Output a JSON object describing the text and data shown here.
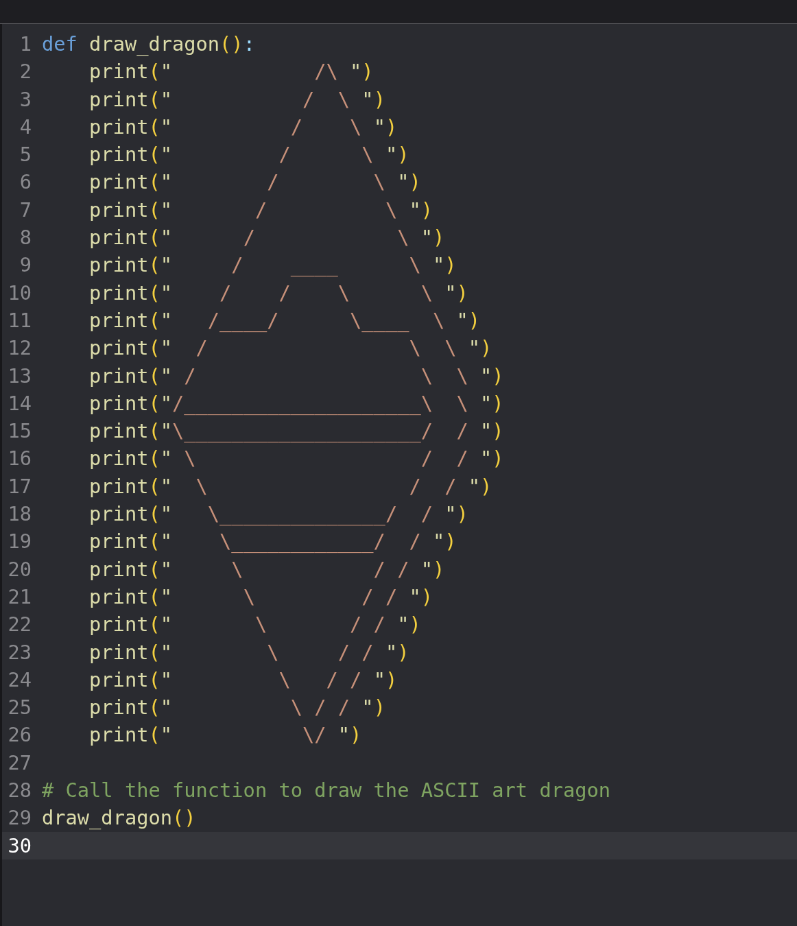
{
  "editor": {
    "lines": [
      {
        "number": "1",
        "indented": false,
        "current": false,
        "tokens": [
          {
            "kind": "keyword",
            "text": "def",
            "spaced": false
          },
          {
            "kind": "name",
            "text": "draw_dragon",
            "spaced": true
          },
          {
            "kind": "paren",
            "text": "()"
          },
          {
            "kind": "colon",
            "text": ":"
          }
        ]
      },
      {
        "number": "2",
        "indented": true,
        "current": false,
        "tokens": [
          {
            "kind": "name",
            "text": "print"
          },
          {
            "kind": "paren",
            "text": "("
          },
          {
            "kind": "quote",
            "text": "\""
          },
          {
            "kind": "art",
            "text": "            /\\ "
          },
          {
            "kind": "quote",
            "text": "\""
          },
          {
            "kind": "paren",
            "text": ")"
          }
        ]
      },
      {
        "number": "3",
        "indented": true,
        "current": false,
        "tokens": [
          {
            "kind": "name",
            "text": "print"
          },
          {
            "kind": "paren",
            "text": "("
          },
          {
            "kind": "quote",
            "text": "\""
          },
          {
            "kind": "art",
            "text": "           /  \\ "
          },
          {
            "kind": "quote",
            "text": "\""
          },
          {
            "kind": "paren",
            "text": ")"
          }
        ]
      },
      {
        "number": "4",
        "indented": true,
        "current": false,
        "tokens": [
          {
            "kind": "name",
            "text": "print"
          },
          {
            "kind": "paren",
            "text": "("
          },
          {
            "kind": "quote",
            "text": "\""
          },
          {
            "kind": "art",
            "text": "          /    \\ "
          },
          {
            "kind": "quote",
            "text": "\""
          },
          {
            "kind": "paren",
            "text": ")"
          }
        ]
      },
      {
        "number": "5",
        "indented": true,
        "current": false,
        "tokens": [
          {
            "kind": "name",
            "text": "print"
          },
          {
            "kind": "paren",
            "text": "("
          },
          {
            "kind": "quote",
            "text": "\""
          },
          {
            "kind": "art",
            "text": "         /      \\ "
          },
          {
            "kind": "quote",
            "text": "\""
          },
          {
            "kind": "paren",
            "text": ")"
          }
        ]
      },
      {
        "number": "6",
        "indented": true,
        "current": false,
        "tokens": [
          {
            "kind": "name",
            "text": "print"
          },
          {
            "kind": "paren",
            "text": "("
          },
          {
            "kind": "quote",
            "text": "\""
          },
          {
            "kind": "art",
            "text": "        /        \\ "
          },
          {
            "kind": "quote",
            "text": "\""
          },
          {
            "kind": "paren",
            "text": ")"
          }
        ]
      },
      {
        "number": "7",
        "indented": true,
        "current": false,
        "tokens": [
          {
            "kind": "name",
            "text": "print"
          },
          {
            "kind": "paren",
            "text": "("
          },
          {
            "kind": "quote",
            "text": "\""
          },
          {
            "kind": "art",
            "text": "       /          \\ "
          },
          {
            "kind": "quote",
            "text": "\""
          },
          {
            "kind": "paren",
            "text": ")"
          }
        ]
      },
      {
        "number": "8",
        "indented": true,
        "current": false,
        "tokens": [
          {
            "kind": "name",
            "text": "print"
          },
          {
            "kind": "paren",
            "text": "("
          },
          {
            "kind": "quote",
            "text": "\""
          },
          {
            "kind": "art",
            "text": "      /            \\ "
          },
          {
            "kind": "quote",
            "text": "\""
          },
          {
            "kind": "paren",
            "text": ")"
          }
        ]
      },
      {
        "number": "9",
        "indented": true,
        "current": false,
        "tokens": [
          {
            "kind": "name",
            "text": "print"
          },
          {
            "kind": "paren",
            "text": "("
          },
          {
            "kind": "quote",
            "text": "\""
          },
          {
            "kind": "art",
            "text": "     /    ____      \\ "
          },
          {
            "kind": "quote",
            "text": "\""
          },
          {
            "kind": "paren",
            "text": ")"
          }
        ]
      },
      {
        "number": "10",
        "indented": true,
        "current": false,
        "tokens": [
          {
            "kind": "name",
            "text": "print"
          },
          {
            "kind": "paren",
            "text": "("
          },
          {
            "kind": "quote",
            "text": "\""
          },
          {
            "kind": "art",
            "text": "    /    /    \\      \\ "
          },
          {
            "kind": "quote",
            "text": "\""
          },
          {
            "kind": "paren",
            "text": ")"
          }
        ]
      },
      {
        "number": "11",
        "indented": true,
        "current": false,
        "tokens": [
          {
            "kind": "name",
            "text": "print"
          },
          {
            "kind": "paren",
            "text": "("
          },
          {
            "kind": "quote",
            "text": "\""
          },
          {
            "kind": "art",
            "text": "   /____/      \\____  \\ "
          },
          {
            "kind": "quote",
            "text": "\""
          },
          {
            "kind": "paren",
            "text": ")"
          }
        ]
      },
      {
        "number": "12",
        "indented": true,
        "current": false,
        "tokens": [
          {
            "kind": "name",
            "text": "print"
          },
          {
            "kind": "paren",
            "text": "("
          },
          {
            "kind": "quote",
            "text": "\""
          },
          {
            "kind": "art",
            "text": "  /                 \\  \\ "
          },
          {
            "kind": "quote",
            "text": "\""
          },
          {
            "kind": "paren",
            "text": ")"
          }
        ]
      },
      {
        "number": "13",
        "indented": true,
        "current": false,
        "tokens": [
          {
            "kind": "name",
            "text": "print"
          },
          {
            "kind": "paren",
            "text": "("
          },
          {
            "kind": "quote",
            "text": "\""
          },
          {
            "kind": "art",
            "text": " /                   \\  \\ "
          },
          {
            "kind": "quote",
            "text": "\""
          },
          {
            "kind": "paren",
            "text": ")"
          }
        ]
      },
      {
        "number": "14",
        "indented": true,
        "current": false,
        "tokens": [
          {
            "kind": "name",
            "text": "print"
          },
          {
            "kind": "paren",
            "text": "("
          },
          {
            "kind": "quote",
            "text": "\""
          },
          {
            "kind": "art",
            "text": "/____________________\\  \\ "
          },
          {
            "kind": "quote",
            "text": "\""
          },
          {
            "kind": "paren",
            "text": ")"
          }
        ]
      },
      {
        "number": "15",
        "indented": true,
        "current": false,
        "tokens": [
          {
            "kind": "name",
            "text": "print"
          },
          {
            "kind": "paren",
            "text": "("
          },
          {
            "kind": "quote",
            "text": "\""
          },
          {
            "kind": "art",
            "text": "\\____________________/  / "
          },
          {
            "kind": "quote",
            "text": "\""
          },
          {
            "kind": "paren",
            "text": ")"
          }
        ]
      },
      {
        "number": "16",
        "indented": true,
        "current": false,
        "tokens": [
          {
            "kind": "name",
            "text": "print"
          },
          {
            "kind": "paren",
            "text": "("
          },
          {
            "kind": "quote",
            "text": "\""
          },
          {
            "kind": "art",
            "text": " \\                   /  / "
          },
          {
            "kind": "quote",
            "text": "\""
          },
          {
            "kind": "paren",
            "text": ")"
          }
        ]
      },
      {
        "number": "17",
        "indented": true,
        "current": false,
        "tokens": [
          {
            "kind": "name",
            "text": "print"
          },
          {
            "kind": "paren",
            "text": "("
          },
          {
            "kind": "quote",
            "text": "\""
          },
          {
            "kind": "art",
            "text": "  \\                 /  / "
          },
          {
            "kind": "quote",
            "text": "\""
          },
          {
            "kind": "paren",
            "text": ")"
          }
        ]
      },
      {
        "number": "18",
        "indented": true,
        "current": false,
        "tokens": [
          {
            "kind": "name",
            "text": "print"
          },
          {
            "kind": "paren",
            "text": "("
          },
          {
            "kind": "quote",
            "text": "\""
          },
          {
            "kind": "art",
            "text": "   \\______________/  / "
          },
          {
            "kind": "quote",
            "text": "\""
          },
          {
            "kind": "paren",
            "text": ")"
          }
        ]
      },
      {
        "number": "19",
        "indented": true,
        "current": false,
        "tokens": [
          {
            "kind": "name",
            "text": "print"
          },
          {
            "kind": "paren",
            "text": "("
          },
          {
            "kind": "quote",
            "text": "\""
          },
          {
            "kind": "art",
            "text": "    \\____________/  / "
          },
          {
            "kind": "quote",
            "text": "\""
          },
          {
            "kind": "paren",
            "text": ")"
          }
        ]
      },
      {
        "number": "20",
        "indented": true,
        "current": false,
        "tokens": [
          {
            "kind": "name",
            "text": "print"
          },
          {
            "kind": "paren",
            "text": "("
          },
          {
            "kind": "quote",
            "text": "\""
          },
          {
            "kind": "art",
            "text": "     \\           / / "
          },
          {
            "kind": "quote",
            "text": "\""
          },
          {
            "kind": "paren",
            "text": ")"
          }
        ]
      },
      {
        "number": "21",
        "indented": true,
        "current": false,
        "tokens": [
          {
            "kind": "name",
            "text": "print"
          },
          {
            "kind": "paren",
            "text": "("
          },
          {
            "kind": "quote",
            "text": "\""
          },
          {
            "kind": "art",
            "text": "      \\         / / "
          },
          {
            "kind": "quote",
            "text": "\""
          },
          {
            "kind": "paren",
            "text": ")"
          }
        ]
      },
      {
        "number": "22",
        "indented": true,
        "current": false,
        "tokens": [
          {
            "kind": "name",
            "text": "print"
          },
          {
            "kind": "paren",
            "text": "("
          },
          {
            "kind": "quote",
            "text": "\""
          },
          {
            "kind": "art",
            "text": "       \\       / / "
          },
          {
            "kind": "quote",
            "text": "\""
          },
          {
            "kind": "paren",
            "text": ")"
          }
        ]
      },
      {
        "number": "23",
        "indented": true,
        "current": false,
        "tokens": [
          {
            "kind": "name",
            "text": "print"
          },
          {
            "kind": "paren",
            "text": "("
          },
          {
            "kind": "quote",
            "text": "\""
          },
          {
            "kind": "art",
            "text": "        \\     / / "
          },
          {
            "kind": "quote",
            "text": "\""
          },
          {
            "kind": "paren",
            "text": ")"
          }
        ]
      },
      {
        "number": "24",
        "indented": true,
        "current": false,
        "tokens": [
          {
            "kind": "name",
            "text": "print"
          },
          {
            "kind": "paren",
            "text": "("
          },
          {
            "kind": "quote",
            "text": "\""
          },
          {
            "kind": "art",
            "text": "         \\   / / "
          },
          {
            "kind": "quote",
            "text": "\""
          },
          {
            "kind": "paren",
            "text": ")"
          }
        ]
      },
      {
        "number": "25",
        "indented": true,
        "current": false,
        "tokens": [
          {
            "kind": "name",
            "text": "print"
          },
          {
            "kind": "paren",
            "text": "("
          },
          {
            "kind": "quote",
            "text": "\""
          },
          {
            "kind": "art",
            "text": "          \\ / / "
          },
          {
            "kind": "quote",
            "text": "\""
          },
          {
            "kind": "paren",
            "text": ")"
          }
        ]
      },
      {
        "number": "26",
        "indented": true,
        "current": false,
        "tokens": [
          {
            "kind": "name",
            "text": "print"
          },
          {
            "kind": "paren",
            "text": "("
          },
          {
            "kind": "quote",
            "text": "\""
          },
          {
            "kind": "art",
            "text": "           \\/ "
          },
          {
            "kind": "quote",
            "text": "\""
          },
          {
            "kind": "paren",
            "text": ")"
          }
        ]
      },
      {
        "number": "27",
        "current": false
      },
      {
        "number": "28",
        "indented": false,
        "current": false,
        "tokens": [
          {
            "kind": "comment",
            "text": "# Call the function to draw the ASCII art dragon"
          }
        ]
      },
      {
        "number": "29",
        "indented": false,
        "current": false,
        "tokens": [
          {
            "kind": "name",
            "text": "draw_dragon"
          },
          {
            "kind": "paren",
            "text": "()"
          }
        ]
      },
      {
        "number": "30",
        "current": true
      }
    ]
  }
}
